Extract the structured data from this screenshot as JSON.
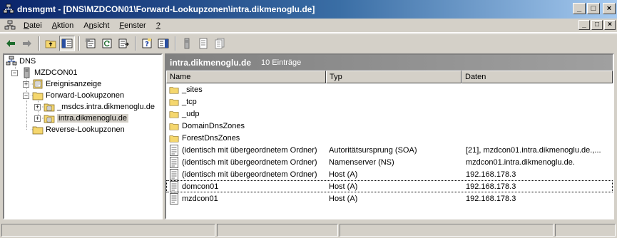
{
  "window": {
    "title": "dnsmgmt - [DNS\\MZDCON01\\Forward-Lookupzonen\\intra.dikmenoglu.de]"
  },
  "window_buttons": {
    "minimize": "_",
    "maximize": "□",
    "close": "×"
  },
  "menu": {
    "items": [
      "Datei",
      "Aktion",
      "Ansicht",
      "Fenster",
      "?"
    ],
    "accel": [
      "D",
      "A",
      "n",
      "F",
      "?"
    ]
  },
  "toolbar": {
    "icons": [
      "back-icon",
      "forward-icon",
      "up-one-level-icon",
      "show-hide-tree-icon",
      "properties-icon",
      "refresh-icon",
      "export-list-icon",
      "help-icon",
      "show-hide-action-pane-icon",
      "server-icon",
      "record-icon",
      "records-icon"
    ]
  },
  "tree": {
    "items": [
      {
        "label": "DNS",
        "icon": "dns-icon",
        "level": 0
      },
      {
        "label": "MZDCON01",
        "icon": "server-icon",
        "level": 1,
        "expander": "−"
      },
      {
        "label": "Ereignisanzeige",
        "icon": "event-viewer-icon",
        "level": 2,
        "expander": "+"
      },
      {
        "label": "Forward-Lookupzonen",
        "icon": "folder-icon",
        "level": 2,
        "expander": "−"
      },
      {
        "label": "_msdcs.intra.dikmenoglu.de",
        "icon": "zone-icon",
        "level": 3,
        "expander": "+"
      },
      {
        "label": "intra.dikmenoglu.de",
        "icon": "zone-icon",
        "level": 3,
        "expander": "+",
        "selected": true
      },
      {
        "label": "Reverse-Lookupzonen",
        "icon": "folder-icon",
        "level": 2
      }
    ]
  },
  "content": {
    "zone_title": "intra.dikmenoglu.de",
    "entry_count": "10 Einträge",
    "columns": [
      "Name",
      "Typ",
      "Daten"
    ],
    "rows": [
      {
        "icon": "folder-icon",
        "name": "_sites",
        "typ": "",
        "daten": ""
      },
      {
        "icon": "folder-icon",
        "name": "_tcp",
        "typ": "",
        "daten": ""
      },
      {
        "icon": "folder-icon",
        "name": "_udp",
        "typ": "",
        "daten": ""
      },
      {
        "icon": "folder-icon",
        "name": "DomainDnsZones",
        "typ": "",
        "daten": ""
      },
      {
        "icon": "folder-icon",
        "name": "ForestDnsZones",
        "typ": "",
        "daten": ""
      },
      {
        "icon": "record-icon",
        "name": "(identisch mit übergeordnetem Ordner)",
        "typ": "Autoritätsursprung (SOA)",
        "daten": "[21], mzdcon01.intra.dikmenoglu.de.,..."
      },
      {
        "icon": "record-icon",
        "name": "(identisch mit übergeordnetem Ordner)",
        "typ": "Namenserver (NS)",
        "daten": "mzdcon01.intra.dikmenoglu.de."
      },
      {
        "icon": "record-icon",
        "name": "(identisch mit übergeordnetem Ordner)",
        "typ": "Host (A)",
        "daten": "192.168.178.3"
      },
      {
        "icon": "record-icon",
        "name": "domcon01",
        "typ": "Host (A)",
        "daten": "192.168.178.3",
        "focused": true
      },
      {
        "icon": "record-icon",
        "name": "mzdcon01",
        "typ": "Host (A)",
        "daten": "192.168.178.3"
      }
    ]
  }
}
